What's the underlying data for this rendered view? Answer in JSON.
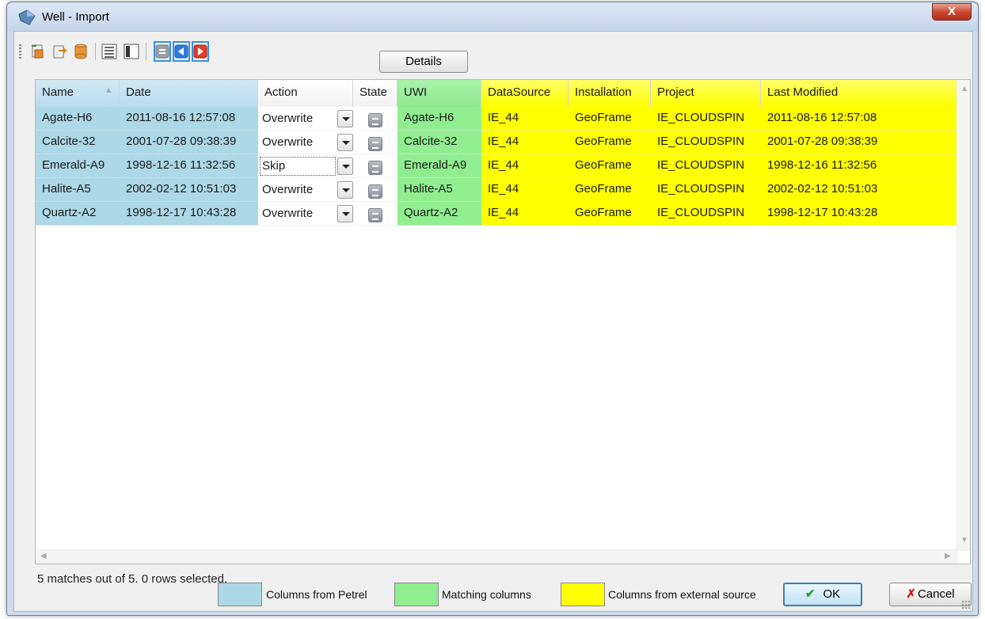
{
  "window": {
    "title": "Well - Import",
    "close_glyph": "X"
  },
  "toolbar": {
    "icons": [
      "import-icon",
      "export-icon",
      "database-icon",
      "list-view-icon",
      "column-view-icon",
      "state-filter-icon",
      "arrow-left-icon",
      "arrow-right-icon"
    ],
    "details_label": "Details"
  },
  "grid": {
    "columns": [
      "Name",
      "Date",
      "Action",
      "State",
      "UWI",
      "DataSource",
      "Installation",
      "Project",
      "Last Modified"
    ],
    "rows": [
      {
        "name": "Agate-H6",
        "date": "2011-08-16 12:57:08",
        "action": "Overwrite",
        "uwi": "Agate-H6",
        "datasource": "IE_44",
        "installation": "GeoFrame",
        "project": "IE_CLOUDSPIN",
        "last_modified": "2011-08-16 12:57:08"
      },
      {
        "name": "Calcite-32",
        "date": "2001-07-28 09:38:39",
        "action": "Overwrite",
        "uwi": "Calcite-32",
        "datasource": "IE_44",
        "installation": "GeoFrame",
        "project": "IE_CLOUDSPIN",
        "last_modified": "2001-07-28 09:38:39"
      },
      {
        "name": "Emerald-A9",
        "date": "1998-12-16 11:32:56",
        "action": "Skip",
        "uwi": "Emerald-A9",
        "datasource": "IE_44",
        "installation": "GeoFrame",
        "project": "IE_CLOUDSPIN",
        "last_modified": "1998-12-16 11:32:56"
      },
      {
        "name": "Halite-A5",
        "date": "2002-02-12 10:51:03",
        "action": "Overwrite",
        "uwi": "Halite-A5",
        "datasource": "IE_44",
        "installation": "GeoFrame",
        "project": "IE_CLOUDSPIN",
        "last_modified": "2002-02-12 10:51:03"
      },
      {
        "name": "Quartz-A2",
        "date": "1998-12-17 10:43:28",
        "action": "Overwrite",
        "uwi": "Quartz-A2",
        "datasource": "IE_44",
        "installation": "GeoFrame",
        "project": "IE_CLOUDSPIN",
        "last_modified": "1998-12-17 10:43:28"
      }
    ]
  },
  "status": {
    "text": "5 matches out of 5.  0 rows selected."
  },
  "legend": {
    "petrel": {
      "label": "Columns from Petrel",
      "color": "#add8e6"
    },
    "matching": {
      "label": "Matching columns",
      "color": "#90ee90"
    },
    "external": {
      "label": "Columns from external source",
      "color": "#ffff00"
    }
  },
  "buttons": {
    "ok_label": "OK",
    "ok_glyph": "✔",
    "cancel_label": "Cancel",
    "cancel_glyph": "✗"
  }
}
